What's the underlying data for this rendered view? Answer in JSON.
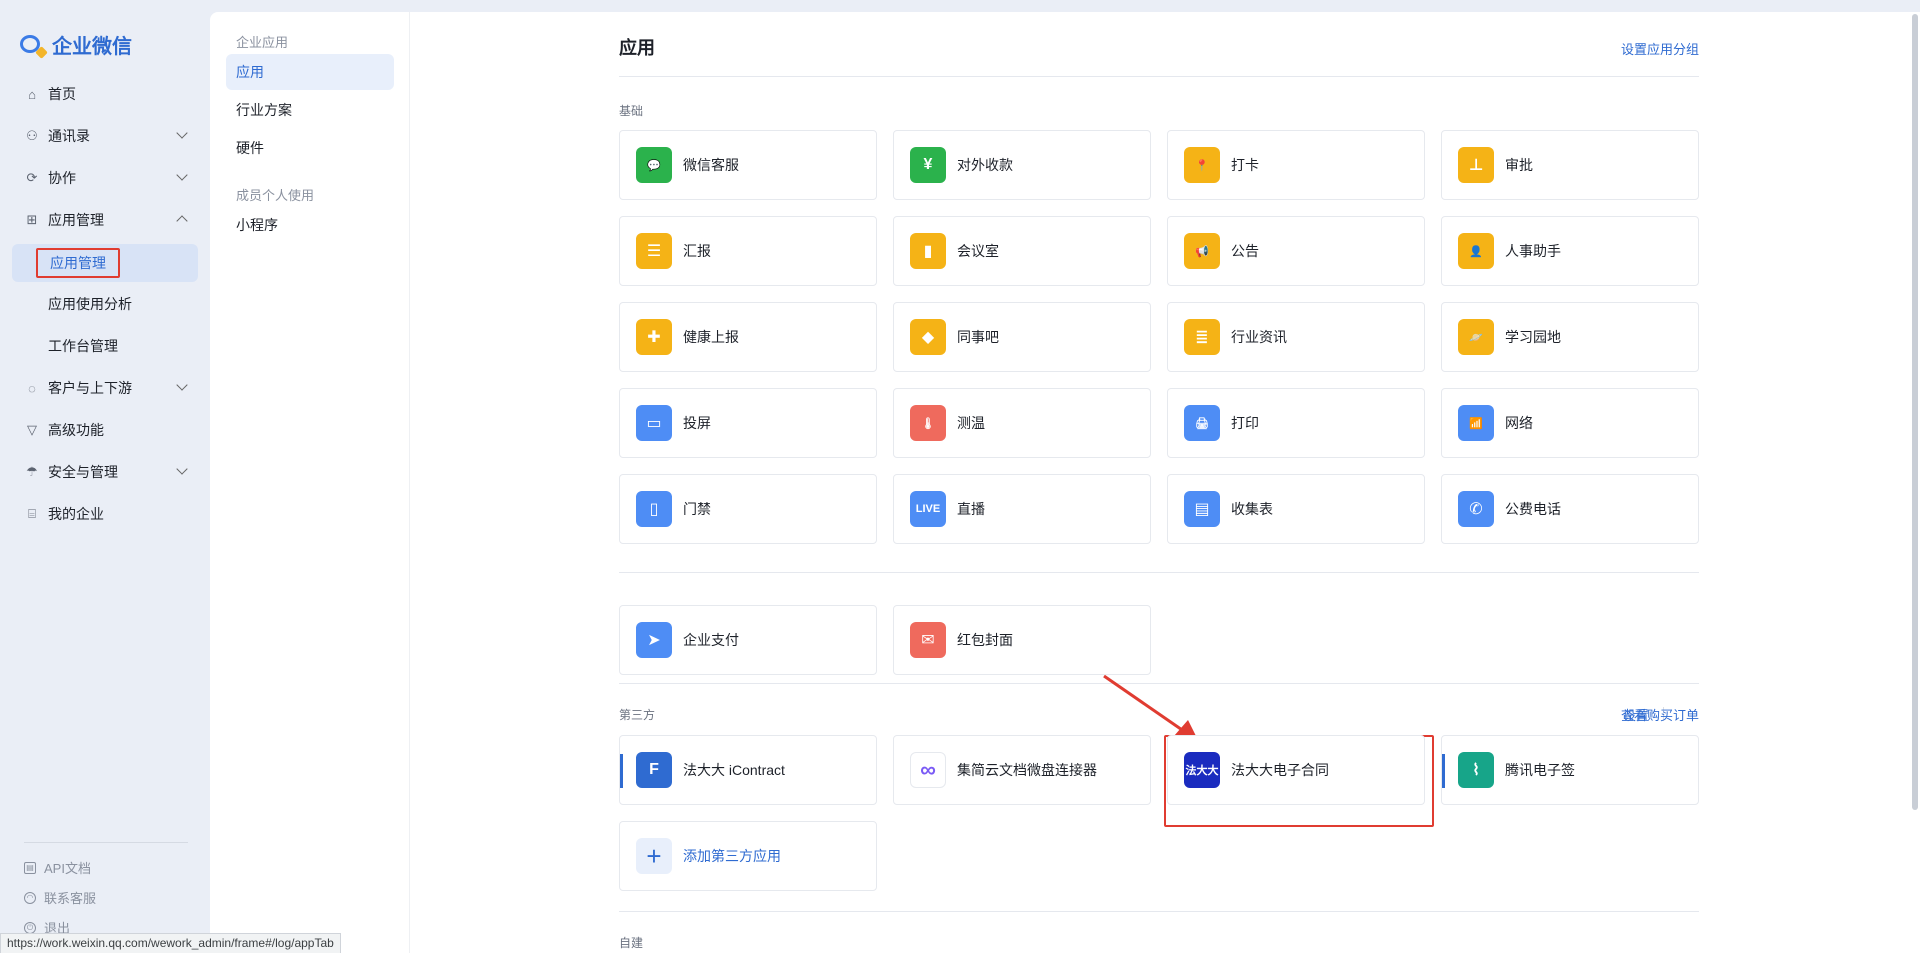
{
  "brand": {
    "name": "企业微信"
  },
  "nav": {
    "items": [
      {
        "label": "首页",
        "icon": "home-icon"
      },
      {
        "label": "通讯录",
        "icon": "contacts-icon"
      },
      {
        "label": "协作",
        "icon": "collab-icon"
      },
      {
        "label": "应用管理",
        "icon": "apps-icon"
      },
      {
        "label": "应用管理"
      },
      {
        "label": "应用使用分析"
      },
      {
        "label": "工作台管理"
      },
      {
        "label": "客户与上下游",
        "icon": "chat-icon"
      },
      {
        "label": "高级功能",
        "icon": "advanced-icon"
      },
      {
        "label": "安全与管理",
        "icon": "security-icon"
      },
      {
        "label": "我的企业",
        "icon": "company-icon"
      }
    ],
    "footer": [
      {
        "label": "API文档"
      },
      {
        "label": "联系客服"
      },
      {
        "label": "退出"
      }
    ]
  },
  "subnav": {
    "group1": "企业应用",
    "items1": [
      "应用",
      "行业方案",
      "硬件"
    ],
    "group2": "成员个人使用",
    "items2": [
      "小程序"
    ]
  },
  "main": {
    "title": "应用",
    "set_group_link": "设置应用分组",
    "section_basic": "基础",
    "basic_apps": [
      {
        "name": "微信客服",
        "color": "#2bb24c",
        "glyph": "💬"
      },
      {
        "name": "对外收款",
        "color": "#2bb24c",
        "glyph": "¥"
      },
      {
        "name": "打卡",
        "color": "#f5b316",
        "glyph": "📍"
      },
      {
        "name": "审批",
        "color": "#f5b316",
        "glyph": "⊥"
      },
      {
        "name": "汇报",
        "color": "#f5b316",
        "glyph": "☰"
      },
      {
        "name": "会议室",
        "color": "#f5b316",
        "glyph": "▮"
      },
      {
        "name": "公告",
        "color": "#f5b316",
        "glyph": "📢"
      },
      {
        "name": "人事助手",
        "color": "#f5b316",
        "glyph": "👤"
      },
      {
        "name": "健康上报",
        "color": "#f5b316",
        "glyph": "✚"
      },
      {
        "name": "同事吧",
        "color": "#f5b316",
        "glyph": "◆"
      },
      {
        "name": "行业资讯",
        "color": "#f5b316",
        "glyph": "≣"
      },
      {
        "name": "学习园地",
        "color": "#f5b316",
        "glyph": "🪐"
      },
      {
        "name": "投屏",
        "color": "#4e8df5",
        "glyph": "▭"
      },
      {
        "name": "测温",
        "color": "#ef6a5d",
        "glyph": "🌡"
      },
      {
        "name": "打印",
        "color": "#4e8df5",
        "glyph": "🖨"
      },
      {
        "name": "网络",
        "color": "#4e8df5",
        "glyph": "📶"
      },
      {
        "name": "门禁",
        "color": "#4e8df5",
        "glyph": "▯"
      },
      {
        "name": "直播",
        "color": "#4e8df5",
        "glyph": "LIVE"
      },
      {
        "name": "收集表",
        "color": "#4e8df5",
        "glyph": "▤"
      },
      {
        "name": "公费电话",
        "color": "#4e8df5",
        "glyph": "✆"
      }
    ],
    "pay_apps": [
      {
        "name": "企业支付",
        "color": "#4e8df5",
        "glyph": "➤"
      },
      {
        "name": "红包封面",
        "color": "#ef6a5d",
        "glyph": "✉"
      }
    ],
    "section_third": "第三方",
    "third_settings": "设置",
    "third_orders": "查看购买订单",
    "third_apps": [
      {
        "name": "法大大 iContract",
        "color": "#2f6bd1",
        "glyph": "F"
      },
      {
        "name": "集简云文档微盘连接器",
        "color": "#ffffff",
        "glyph": "∞"
      },
      {
        "name": "法大大电子合同",
        "color": "#1a2bbf",
        "glyph": "法大大"
      },
      {
        "name": "腾讯电子签",
        "color": "#17a589",
        "glyph": "⌇"
      }
    ],
    "add_third": "添加第三方应用",
    "section_custom": "自建"
  },
  "status_url": "https://work.weixin.qq.com/wework_admin/frame#/log/appTab"
}
